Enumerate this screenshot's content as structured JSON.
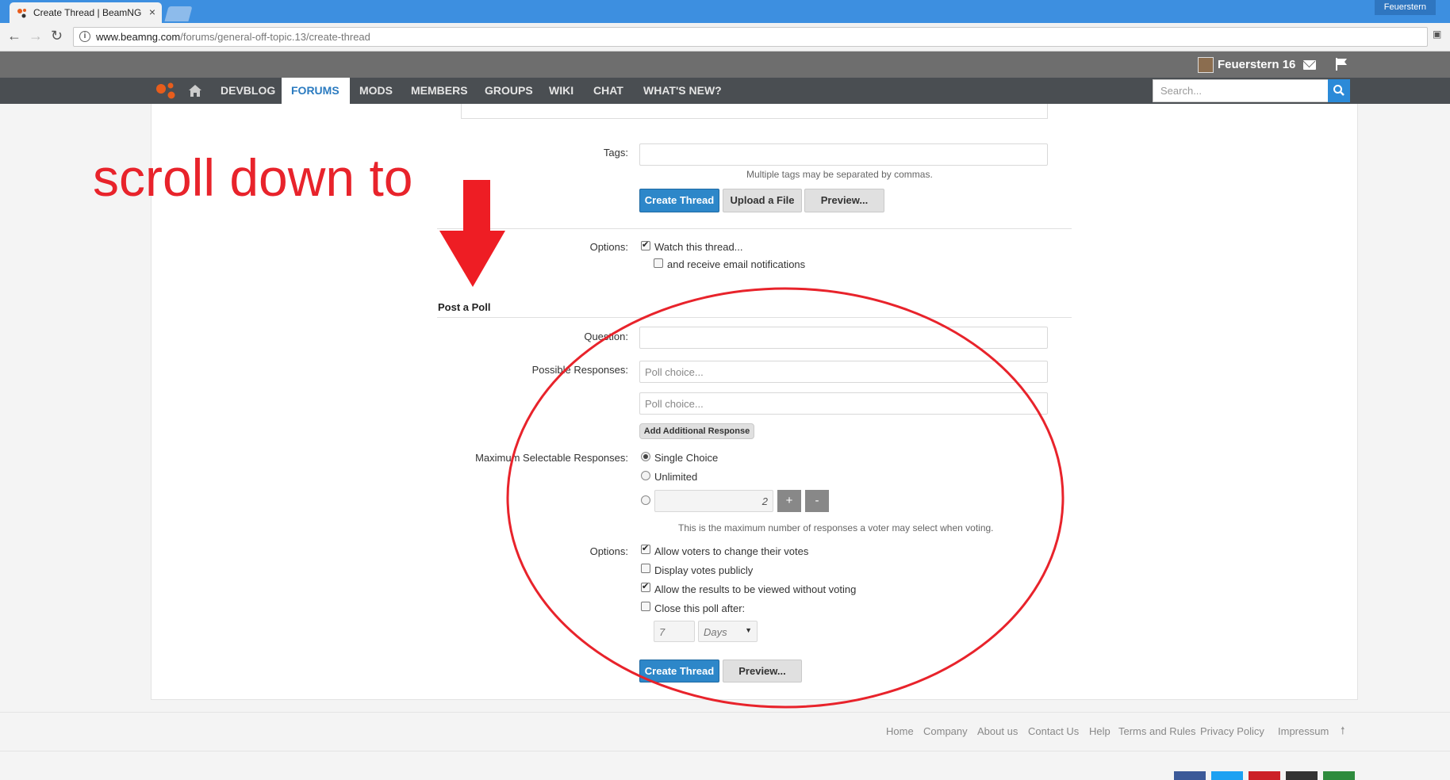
{
  "browser": {
    "tab_title": "Create Thread | BeamNG",
    "tab_close": "×",
    "profile_name": "Feuerstern",
    "url_domain": "www.beamng.com",
    "url_path": "/forums/general-off-topic.13/create-thread"
  },
  "header": {
    "username": "Feuerstern 16",
    "nav": [
      "DEVBLOG",
      "FORUMS",
      "MODS",
      "MEMBERS",
      "GROUPS",
      "WIKI",
      "CHAT",
      "WHAT'S NEW?"
    ],
    "active_nav": "FORUMS",
    "search_placeholder": "Search..."
  },
  "form": {
    "tags_label": "Tags:",
    "tags_hint": "Multiple tags may be separated by commas.",
    "create_thread": "Create Thread",
    "upload_file": "Upload a File",
    "preview": "Preview...",
    "options_label": "Options:",
    "watch_thread": "Watch this thread...",
    "email_notifications": "and receive email notifications",
    "poll_title": "Post a Poll",
    "question_label": "Question:",
    "responses_label": "Possible Responses:",
    "poll_choice_placeholder": "Poll choice...",
    "add_response": "Add Additional Response",
    "max_responses_label": "Maximum Selectable Responses:",
    "single_choice": "Single Choice",
    "unlimited": "Unlimited",
    "max_value": "2",
    "plus": "+",
    "minus": "-",
    "max_hint": "This is the maximum number of responses a voter may select when voting.",
    "poll_options_label": "Options:",
    "allow_change": "Allow voters to change their votes",
    "display_public": "Display votes publicly",
    "view_without_voting": "Allow the results to be viewed without voting",
    "close_after": "Close this poll after:",
    "close_value": "7",
    "close_unit": "Days",
    "create_thread_bottom": "Create Thread",
    "preview_bottom": "Preview..."
  },
  "footer": {
    "links": [
      "Home",
      "Company",
      "About us",
      "Contact Us",
      "Help",
      "Terms and Rules",
      "Privacy Policy",
      "Impressum"
    ],
    "social_colors": [
      "#3b5998",
      "#1da1f2",
      "#cc2127",
      "#333333",
      "#2e8b3d"
    ]
  },
  "annotation": {
    "text": "scroll down to",
    "color": "#e8232b"
  }
}
